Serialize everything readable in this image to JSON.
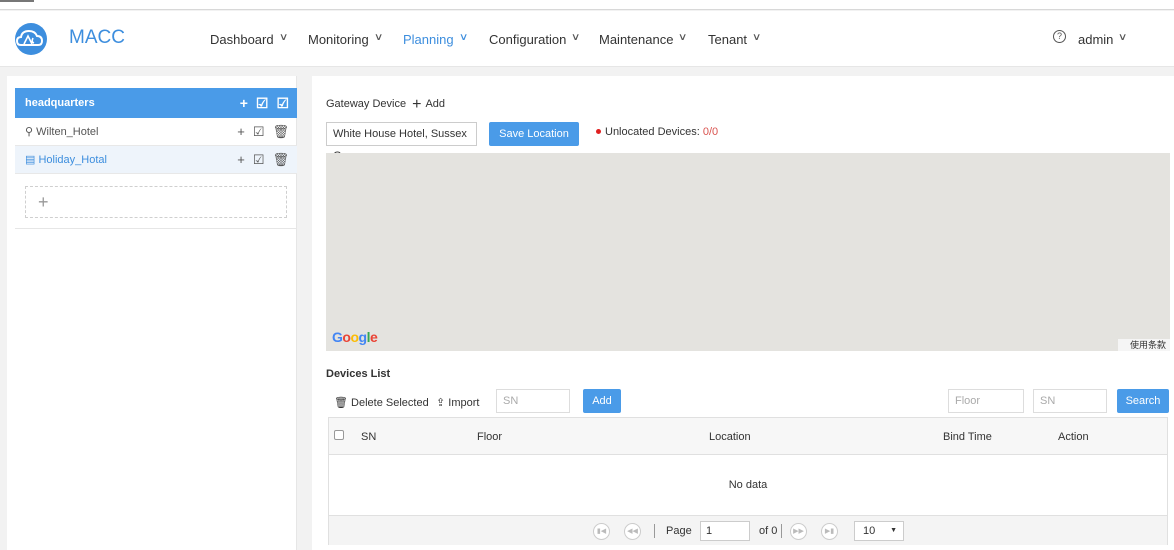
{
  "app": {
    "name": "MACC"
  },
  "nav": {
    "dashboard": "Dashboard",
    "monitoring": "Monitoring",
    "planning": "Planning",
    "configuration": "Configuration",
    "maintenance": "Maintenance",
    "tenant": "Tenant",
    "user": "admin"
  },
  "sidebar": {
    "root": "headquarters",
    "items": [
      "Wilten_Hotel",
      "Holiday_Hotal"
    ],
    "add_symbol": "+"
  },
  "gateway": {
    "label": "Gateway Device",
    "add": "Add"
  },
  "location": {
    "value": "White House Hotel, Sussex G",
    "save_button": "Save Location",
    "unlocated_label": "Unlocated Devices:",
    "unlocated_count": "0/0"
  },
  "map": {
    "brand": "Google",
    "terms": "使用条款"
  },
  "devices": {
    "title": "Devices List",
    "delete_selected": "Delete Selected",
    "import": "Import",
    "sn_placeholder": "SN",
    "add_button": "Add",
    "floor_placeholder": "Floor",
    "sn_filter_placeholder": "SN",
    "search_button": "Search",
    "columns": [
      "SN",
      "Floor",
      "Location",
      "Bind Time",
      "Action"
    ],
    "empty": "No data"
  },
  "pagination": {
    "page_label": "Page",
    "page": "1",
    "of_label": "of 0",
    "page_size": "10"
  },
  "colors": {
    "accent": "#4a9be8",
    "brand": "#3d8ede",
    "alert": "#e02020"
  }
}
